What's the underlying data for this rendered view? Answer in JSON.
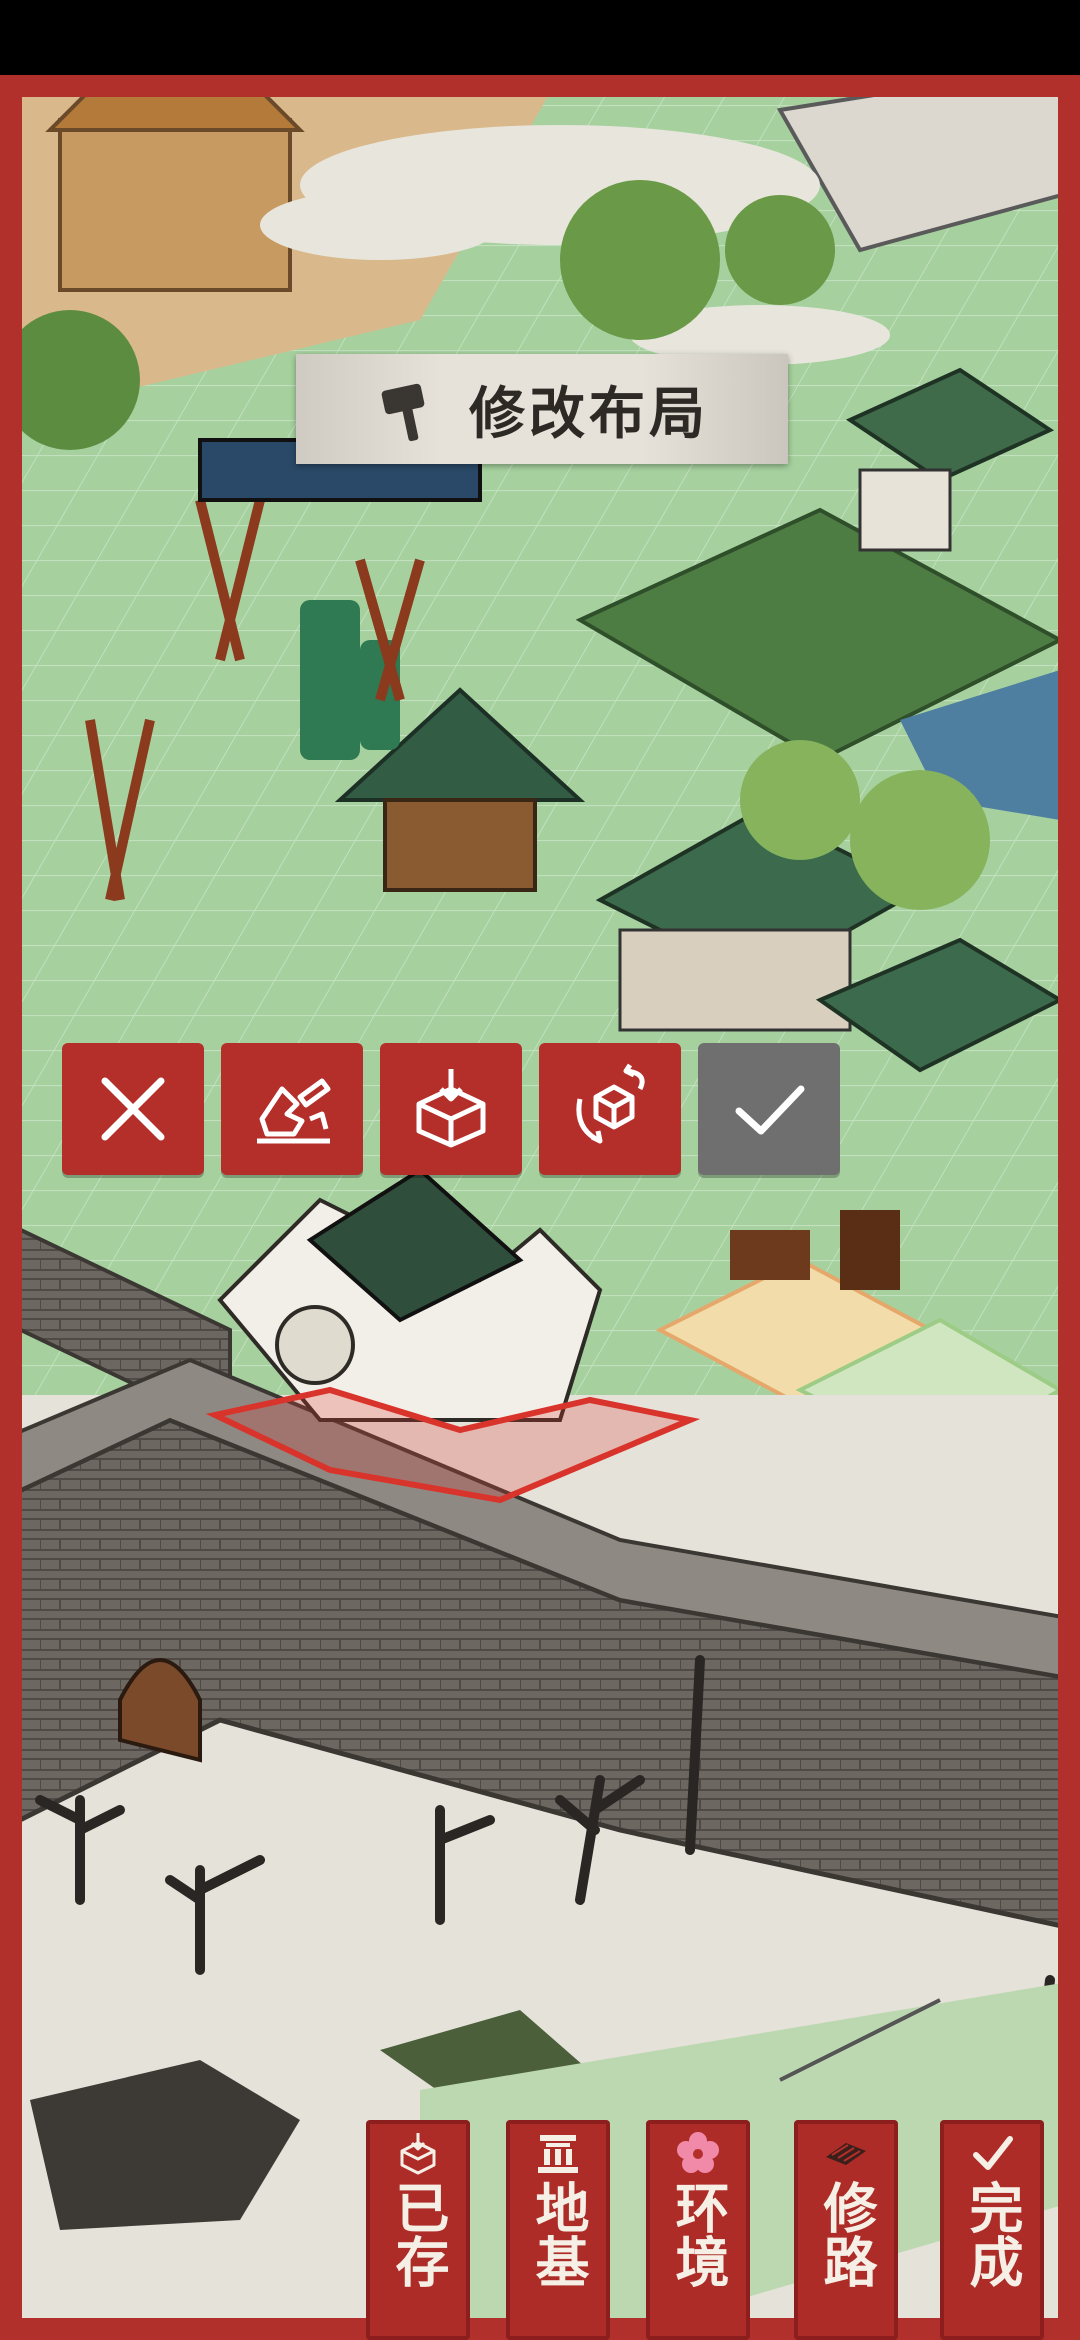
{
  "header": {
    "mode_title": "修改布局",
    "mode_icon": "hammer-icon"
  },
  "action_bar": [
    {
      "id": "cancel",
      "icon": "close-icon",
      "enabled": true
    },
    {
      "id": "demolish",
      "icon": "demolish-icon",
      "enabled": true
    },
    {
      "id": "store",
      "icon": "store-box-icon",
      "enabled": true
    },
    {
      "id": "rotate",
      "icon": "rotate-icon",
      "enabled": true
    },
    {
      "id": "confirm",
      "icon": "check-icon",
      "enabled": false
    }
  ],
  "bottom_menu": [
    {
      "id": "stored",
      "label": "已存",
      "icon": "stored-box-icon"
    },
    {
      "id": "foundation",
      "label": "地基",
      "icon": "foundation-icon"
    },
    {
      "id": "environment",
      "label": "环境",
      "icon": "blossom-icon"
    },
    {
      "id": "road",
      "label": "修路",
      "icon": "road-icon"
    },
    {
      "id": "done",
      "label": "完成",
      "icon": "check-icon"
    }
  ],
  "colors": {
    "frame_red": "#b2302b",
    "button_red": "#b42e2a",
    "disabled_gray": "#6f6f6f",
    "grass": "#a9d3a3",
    "wall": "#6f6a64",
    "snow": "#e7e3dc"
  }
}
